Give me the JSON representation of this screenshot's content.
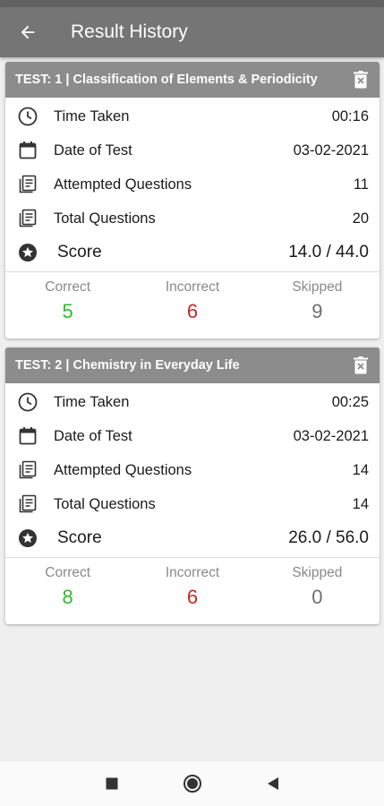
{
  "appbar": {
    "title": "Result History"
  },
  "colors": {
    "correct": "#2dbd2d",
    "incorrect": "#c62828",
    "skipped": "#6e6e6e"
  },
  "cards": [
    {
      "title": "TEST: 1 | Classification of Elements & Periodicity",
      "rows": {
        "time_label": "Time Taken",
        "time_value": "00:16",
        "date_label": "Date of Test",
        "date_value": "03-02-2021",
        "attempted_label": "Attempted Questions",
        "attempted_value": "11",
        "total_label": "Total Questions",
        "total_value": "20",
        "score_label": "Score",
        "score_value": "14.0 / 44.0"
      },
      "stats": {
        "correct_label": "Correct",
        "correct_value": "5",
        "incorrect_label": "Incorrect",
        "incorrect_value": "6",
        "skipped_label": "Skipped",
        "skipped_value": "9"
      }
    },
    {
      "title": "TEST: 2 | Chemistry in Everyday Life",
      "rows": {
        "time_label": "Time Taken",
        "time_value": "00:25",
        "date_label": "Date of Test",
        "date_value": "03-02-2021",
        "attempted_label": "Attempted Questions",
        "attempted_value": "14",
        "total_label": "Total Questions",
        "total_value": "14",
        "score_label": "Score",
        "score_value": "26.0 / 56.0"
      },
      "stats": {
        "correct_label": "Correct",
        "correct_value": "8",
        "incorrect_label": "Incorrect",
        "incorrect_value": "6",
        "skipped_label": "Skipped",
        "skipped_value": "0"
      }
    }
  ]
}
